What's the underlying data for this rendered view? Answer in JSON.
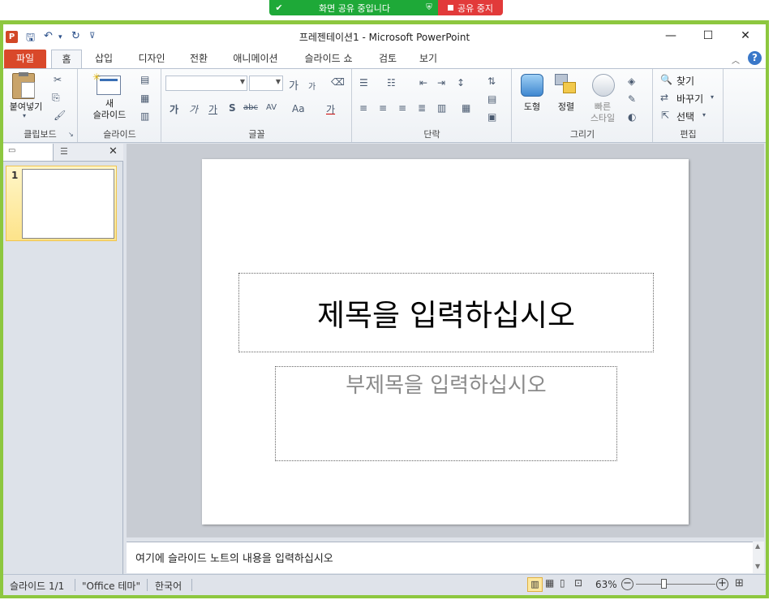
{
  "share_banner": {
    "status_label": "화면 공유 중입니다",
    "stop_label": "공유 중지"
  },
  "window": {
    "title": "프레젠테이션1 - Microsoft PowerPoint",
    "app_icon_letter": "P"
  },
  "tabs": [
    {
      "label": "파일"
    },
    {
      "label": "홈"
    },
    {
      "label": "삽입"
    },
    {
      "label": "디자인"
    },
    {
      "label": "전환"
    },
    {
      "label": "애니메이션"
    },
    {
      "label": "슬라이드 쇼"
    },
    {
      "label": "검토"
    },
    {
      "label": "보기"
    }
  ],
  "ribbon": {
    "clipboard": {
      "label": "클립보드",
      "paste_label": "붙여넣기"
    },
    "slides": {
      "label": "슬라이드",
      "new_slide_line1": "새",
      "new_slide_line2": "슬라이드"
    },
    "font": {
      "label": "글꼴",
      "grow": "가",
      "shrink": "가",
      "bold": "가",
      "italic": "가",
      "underline": "가",
      "shadow": "S",
      "strike": "abc",
      "spacing": "AV",
      "case": "Aa",
      "color": "가"
    },
    "paragraph": {
      "label": "단락"
    },
    "drawing": {
      "label": "그리기",
      "shapes_label": "도형",
      "arrange_label": "정렬",
      "quick_styles_line1": "빠른",
      "quick_styles_line2": "스타일"
    },
    "editing": {
      "label": "편집",
      "find_label": "찾기",
      "replace_label": "바꾸기",
      "select_label": "선택"
    }
  },
  "thumbnail": {
    "number": "1"
  },
  "slide": {
    "title_placeholder": "제목을 입력하십시오",
    "subtitle_placeholder": "부제목을 입력하십시오"
  },
  "notes": {
    "placeholder": "여기에 슬라이드 노트의 내용을 입력하십시오"
  },
  "status": {
    "slide_info": "슬라이드 1/1",
    "theme": "\"Office 테마\"",
    "language": "한국어",
    "zoom": "63%",
    "zoom_fraction": 0.35
  },
  "colors": {
    "share_green": "#1ea938",
    "share_red": "#e23a3a",
    "frame_green": "#8dc73f",
    "file_tab": "#d9482a"
  }
}
